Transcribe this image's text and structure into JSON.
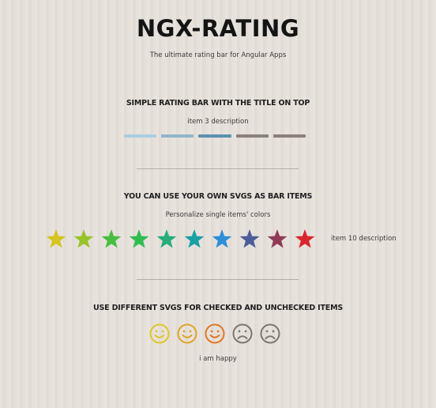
{
  "header": {
    "title": "NGX-RATING",
    "subtitle": "The ultimate rating bar for Angular Apps"
  },
  "section_bar": {
    "title": "SIMPLE RATING BAR WITH THE TITLE ON TOP",
    "description": "item 3 description",
    "rating": 3,
    "max": 5,
    "item_colors": [
      "#a9cfdf",
      "#8fb6cc",
      "#5c90b0",
      "#8a8079",
      "#8a8079"
    ]
  },
  "section_svgs": {
    "title": "YOU CAN USE YOUR OWN SVGS AS BAR ITEMS",
    "subtitle": "Personalize single items' colors",
    "description": "item 10 description",
    "rating": 10,
    "max": 10,
    "icon": "star-icon",
    "star_colors": [
      "#d4c520",
      "#98c42b",
      "#45bf3f",
      "#30bd4f",
      "#26ad7a",
      "#1aa0a4",
      "#2d8fd8",
      "#4a5e99",
      "#903a55",
      "#d8262c"
    ]
  },
  "section_faces": {
    "title": "USE DIFFERENT SVGS FOR CHECKED AND UNCHECKED ITEMS",
    "description": "i am happy",
    "rating": 3,
    "max": 5,
    "faces": [
      {
        "icon": "happy-face-icon",
        "color": "#e0c62a"
      },
      {
        "icon": "happy-face-icon",
        "color": "#e0a52a"
      },
      {
        "icon": "happy-face-icon",
        "color": "#e0792a"
      },
      {
        "icon": "sad-face-icon",
        "color": "#7d7770"
      },
      {
        "icon": "sad-face-icon",
        "color": "#7d7770"
      }
    ]
  }
}
